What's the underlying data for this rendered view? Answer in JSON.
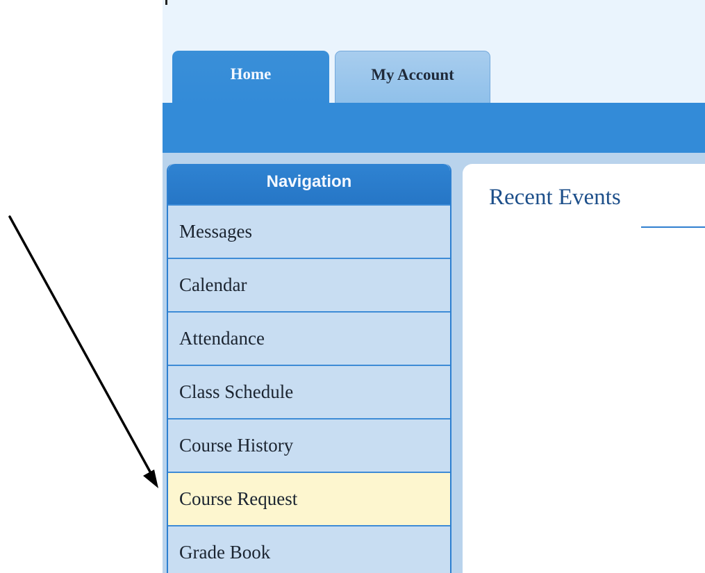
{
  "tabs": [
    {
      "label": "Home",
      "active": true
    },
    {
      "label": "My Account",
      "active": false
    }
  ],
  "navigation": {
    "title": "Navigation",
    "items": [
      {
        "label": "Messages",
        "highlighted": false
      },
      {
        "label": "Calendar",
        "highlighted": false
      },
      {
        "label": "Attendance",
        "highlighted": false
      },
      {
        "label": "Class Schedule",
        "highlighted": false
      },
      {
        "label": "Course History",
        "highlighted": false
      },
      {
        "label": "Course Request",
        "highlighted": true
      },
      {
        "label": "Grade Book",
        "highlighted": false
      }
    ]
  },
  "content": {
    "title": "Recent Events"
  },
  "colors": {
    "primary_blue": "#338bd8",
    "nav_background": "#c8ddf2",
    "highlight": "#fdf6cf",
    "title_text": "#1d4f8a"
  }
}
